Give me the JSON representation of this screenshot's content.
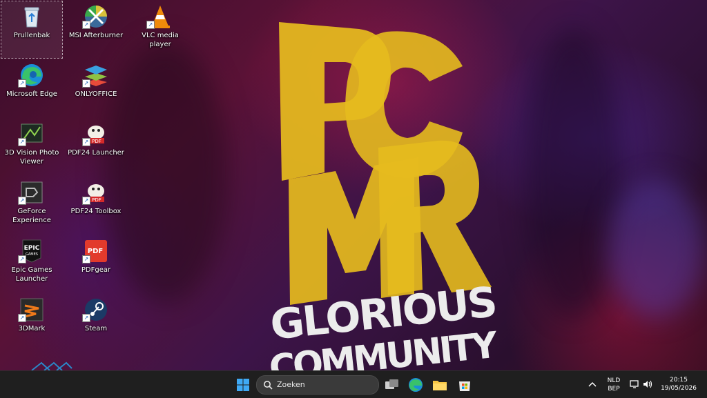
{
  "desktop": {
    "icons": [
      {
        "label": "Prullenbak",
        "icon": "recycle-bin-icon"
      },
      {
        "label": "MSI Afterburner",
        "icon": "msi-afterburner-icon"
      },
      {
        "label": "VLC media player",
        "icon": "vlc-icon"
      },
      {
        "label": "Microsoft Edge",
        "icon": "edge-icon"
      },
      {
        "label": "ONLYOFFICE",
        "icon": "onlyoffice-icon"
      },
      {
        "label": "3D Vision Photo Viewer",
        "icon": "3d-vision-icon"
      },
      {
        "label": "PDF24 Launcher",
        "icon": "pdf24-launcher-icon"
      },
      {
        "label": "GeForce Experience",
        "icon": "geforce-icon"
      },
      {
        "label": "PDF24 Toolbox",
        "icon": "pdf24-toolbox-icon"
      },
      {
        "label": "Epic Games Launcher",
        "icon": "epic-games-icon"
      },
      {
        "label": "PDFgear",
        "icon": "pdfgear-icon"
      },
      {
        "label": "3DMark",
        "icon": "3dmark-icon"
      },
      {
        "label": "Steam",
        "icon": "steam-icon"
      }
    ],
    "wallpaper": {
      "line1": "GLORIOUS",
      "line2": "COMMUNITY",
      "accent": "#e6bb1e"
    }
  },
  "taskbar": {
    "search_placeholder": "Zoeken",
    "language": "NLD",
    "layout": "BEP",
    "time": "20:15",
    "date": "19/05/2026"
  }
}
